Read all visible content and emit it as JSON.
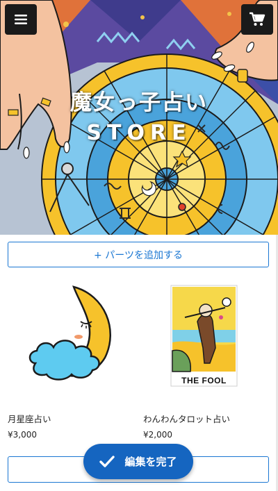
{
  "header": {
    "menu_icon": "hamburger-menu-icon",
    "cart_icon": "shopping-cart-icon"
  },
  "hero": {
    "title_jp": "魔女っ子占い",
    "title_en": "STORE"
  },
  "add_parts": {
    "label": "+ パーツを追加する"
  },
  "products": [
    {
      "name": "月星座占い",
      "price": "¥3,000",
      "image": "crescent-moon-on-cloud"
    },
    {
      "name": "わんわんタロット占い",
      "price": "¥2,000",
      "image": "tarot-card-the-fool-dog",
      "card_caption": "THE FOOL"
    }
  ],
  "floating_action": {
    "label": "編集を完了",
    "icon": "check-icon",
    "color": "#1565c0"
  },
  "colors": {
    "accent": "#1976d2",
    "hero_wheel_yellow": "#f6c22b",
    "hero_wheel_blue": "#7fc8ee"
  }
}
